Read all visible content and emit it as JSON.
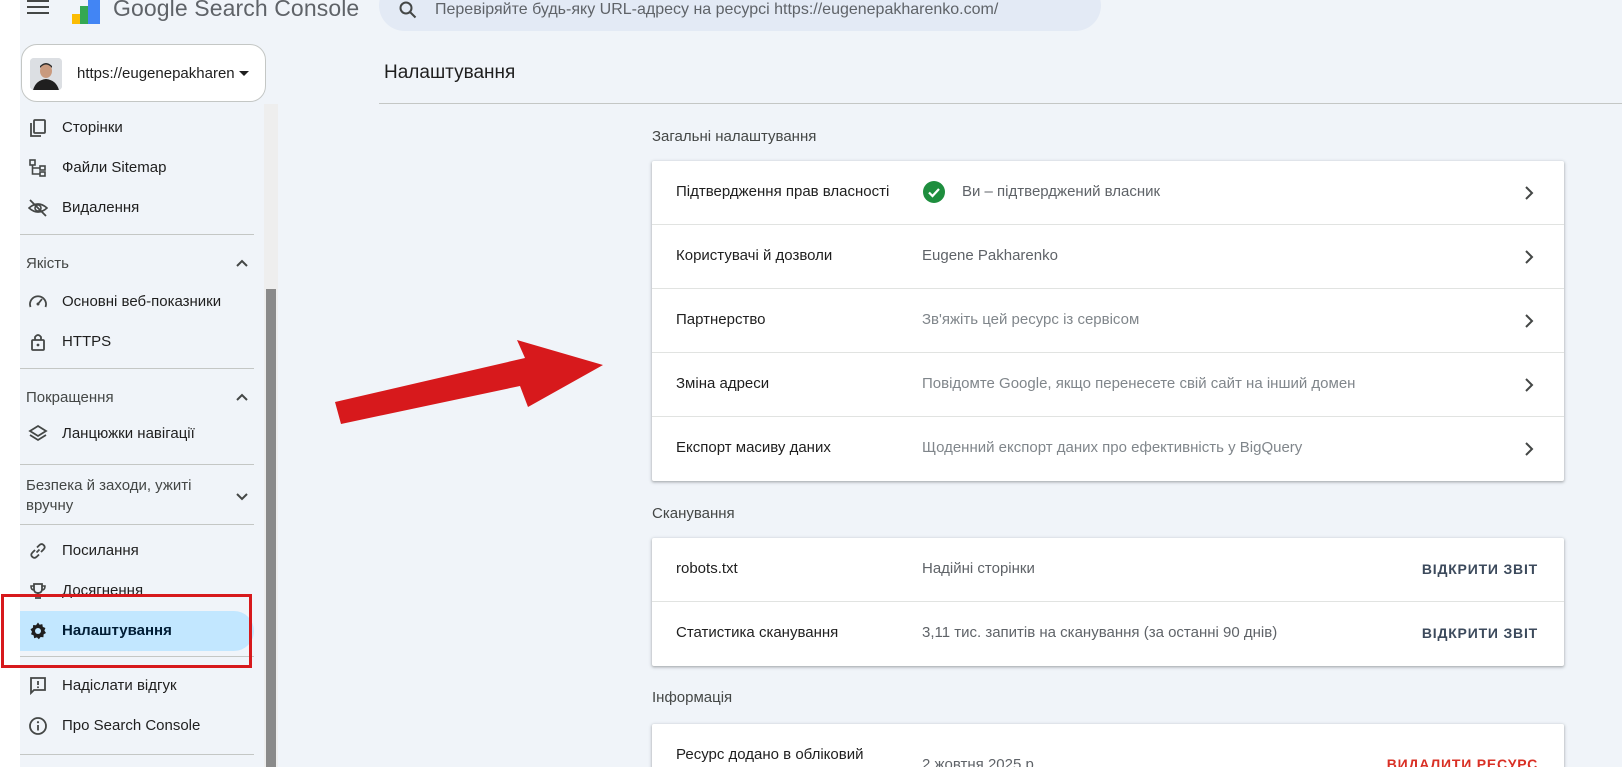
{
  "header": {
    "app_title": "Google Search Console",
    "search_placeholder": "Перевіряйте будь-яку URL-адресу на ресурсі https://eugenepakharenko.com/"
  },
  "property": {
    "url": "https://eugenepakharen"
  },
  "sidebar": {
    "items_top": [
      {
        "label": "Сторінки",
        "icon": "pages-icon"
      },
      {
        "label": "Файли Sitemap",
        "icon": "sitemap-icon"
      },
      {
        "label": "Видалення",
        "icon": "removals-icon"
      }
    ],
    "sections": [
      {
        "title": "Якість",
        "expanded": true,
        "items": [
          {
            "label": "Основні веб-показники",
            "icon": "speedometer-icon"
          },
          {
            "label": "HTTPS",
            "icon": "lock-icon"
          }
        ]
      },
      {
        "title": "Покращення",
        "expanded": true,
        "items": [
          {
            "label": "Ланцюжки навігації",
            "icon": "layers-icon"
          }
        ]
      },
      {
        "title": "Безпека й заходи, ужиті вручну",
        "expanded": false,
        "items": []
      }
    ],
    "items_bottom": [
      {
        "label": "Посилання",
        "icon": "link-icon"
      },
      {
        "label": "Досягнення",
        "icon": "trophy-icon"
      },
      {
        "label": "Налаштування",
        "icon": "gear-icon",
        "active": true
      }
    ],
    "items_footer": [
      {
        "label": "Надіслати відгук",
        "icon": "feedback-icon"
      },
      {
        "label": "Про Search Console",
        "icon": "info-icon"
      }
    ]
  },
  "main": {
    "title": "Налаштування",
    "groups": [
      {
        "title": "Загальні налаштування",
        "rows": [
          {
            "label": "Підтвердження прав власності",
            "value": "Ви – підтверджений власник",
            "check": true
          },
          {
            "label": "Користувачі й дозволи",
            "value": "Eugene Pakharenko"
          },
          {
            "label": "Партнерство",
            "value": "Зв'яжіть цей ресурс із сервісом"
          },
          {
            "label": "Зміна адреси",
            "value": "Повідомте Google, якщо перенесете свій сайт на інший домен"
          },
          {
            "label": "Експорт масиву даних",
            "value": "Щоденний експорт даних про ефективність у BigQuery"
          }
        ]
      },
      {
        "title": "Сканування",
        "rows": [
          {
            "label": "robots.txt",
            "value": "Надійні сторінки",
            "action": "ВІДКРИТИ ЗВІТ"
          },
          {
            "label": "Статистика сканування",
            "value": "3,11 тис. запитів на сканування (за останні 90 днів)",
            "action": "ВІДКРИТИ ЗВІТ"
          }
        ]
      },
      {
        "title": "Інформація",
        "rows": [
          {
            "label": "Ресурс додано в обліковий",
            "value": "2 жовтня 2025 р.",
            "action": "ВИДАЛИТИ РЕСУРС"
          }
        ]
      }
    ]
  },
  "colors": {
    "active_nav_bg": "#c2e7ff",
    "highlight_annotation": "#d7191c",
    "check_green": "#1e8e3e",
    "danger": "#d93025"
  }
}
